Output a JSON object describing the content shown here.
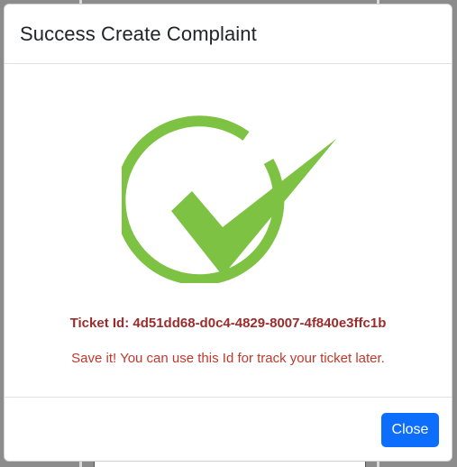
{
  "modal": {
    "title": "Success Create Complaint",
    "ticket_label": "Ticket Id: 4d51dd68-d0c4-4829-8007-4f840e3ffc1b",
    "save_message": "Save it! You can use this Id for track your ticket later.",
    "close_label": "Close",
    "success_icon": "check-circle-icon"
  },
  "colors": {
    "check_green": "#7dc242",
    "ticket_text": "#9b2c2c",
    "message_text": "#c0392b",
    "close_button": "#0d6efd"
  }
}
